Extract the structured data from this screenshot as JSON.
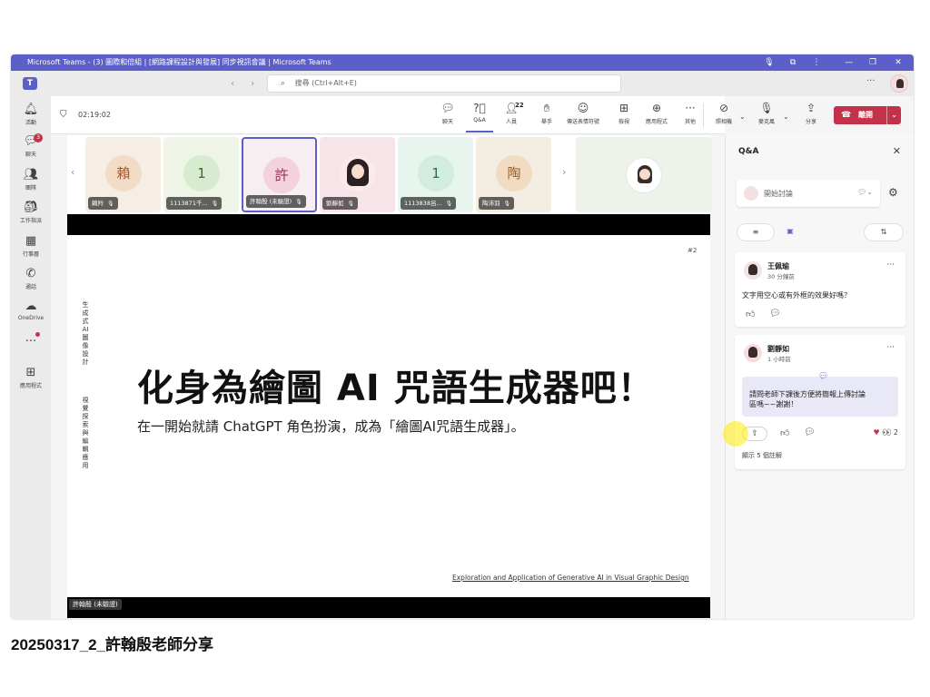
{
  "window": {
    "title": "Microsoft Teams - (3) 圖際和倍組 | [網路課程設計與發展] 同步視訊會議 | Microsoft Teams"
  },
  "topbar": {
    "search_placeholder": "搜尋 (Ctrl+Alt+E)"
  },
  "rail": {
    "items": [
      {
        "label": "活動",
        "icon": "bell-icon"
      },
      {
        "label": "聊天",
        "icon": "chat-icon",
        "badge": "3"
      },
      {
        "label": "團隊",
        "icon": "teams-icon"
      },
      {
        "label": "工作指派",
        "icon": "assignment-icon"
      },
      {
        "label": "行事曆",
        "icon": "calendar-icon"
      },
      {
        "label": "通話",
        "icon": "phone-icon"
      },
      {
        "label": "OneDrive",
        "icon": "cloud-icon"
      },
      {
        "label": "",
        "icon": "more-icon"
      },
      {
        "label": "應用程式",
        "icon": "apps-icon"
      }
    ]
  },
  "meeting": {
    "timer": "02:19:02",
    "toolbar": [
      {
        "label": "聊天",
        "icon": "chat-icon"
      },
      {
        "label": "Q&A",
        "icon": "qa-icon",
        "active": true
      },
      {
        "label": "人員",
        "icon": "people-icon",
        "count": "22"
      },
      {
        "label": "舉手",
        "icon": "raise-hand-icon"
      },
      {
        "label": "傳送表情符號",
        "icon": "emoji-icon"
      },
      {
        "label": "檢視",
        "icon": "view-icon"
      },
      {
        "label": "應用程式",
        "icon": "add-app-icon"
      },
      {
        "label": "其他",
        "icon": "more-icon"
      },
      {
        "label": "照相機",
        "icon": "camera-off-icon"
      },
      {
        "label": "麥克風",
        "icon": "mic-icon"
      },
      {
        "label": "分享",
        "icon": "share-icon"
      }
    ],
    "leave_label": "離開"
  },
  "participants": [
    {
      "initial": "賴",
      "name": "賴羚",
      "bg": "#f6ede4",
      "avatar_bg": "#f2dcc8",
      "avatar_fg": "#a0582d"
    },
    {
      "initial": "1",
      "name": "1113871千...",
      "bg": "#eef4e6",
      "avatar_bg": "#d6ebcf",
      "avatar_fg": "#3c6b2f"
    },
    {
      "initial": "許",
      "name": "許翰殷 (未驗證)",
      "bg": "#f6eef0",
      "avatar_bg": "#f4d2dc",
      "avatar_fg": "#8f3553",
      "selected": true
    },
    {
      "initial": "",
      "name": "劉靜如",
      "bg": "#f7e4e8",
      "photo": true
    },
    {
      "initial": "1",
      "name": "1113838呂...",
      "bg": "#e8f4ee",
      "avatar_bg": "#d2ecdf",
      "avatar_fg": "#2c6b4c"
    },
    {
      "initial": "陶",
      "name": "陶沛羽",
      "bg": "#f4ede2",
      "avatar_bg": "#f1dcc2",
      "avatar_fg": "#9b5d27"
    }
  ],
  "slide": {
    "number": "#2",
    "side_text_1": "生成式AI圖像設計",
    "side_text_2": "視覺探索與編輯應用",
    "title": "化身為繪圖 AI 咒語生成器吧！",
    "subtitle": "在一開始就請 ChatGPT 角色扮演，成為「繪圖AI咒語生成器」。",
    "footer": "Exploration and Application of Generative AI in Visual Graphic Design",
    "presenter": "許翰殷 (未驗證)"
  },
  "qa": {
    "title": "Q&A",
    "compose_placeholder": "開始討論",
    "posts": [
      {
        "author": "王佩瑜",
        "time": "30 分鐘前",
        "text": "文字用空心或有外框的效果好嗎？"
      },
      {
        "author": "劉靜如",
        "time": "1 小時前",
        "text_line1": "請問老師下課後方便將簡報上傳討論",
        "text_line2": "區嗎~~謝謝！",
        "reaction_count": "2",
        "show_replies": "顯示 5 個註解"
      }
    ]
  },
  "caption": "20250317_2_許翰殷老師分享",
  "colors": {
    "brand": "#5b5fc7",
    "leave": "#c4314b",
    "badge": "#c4314b"
  }
}
